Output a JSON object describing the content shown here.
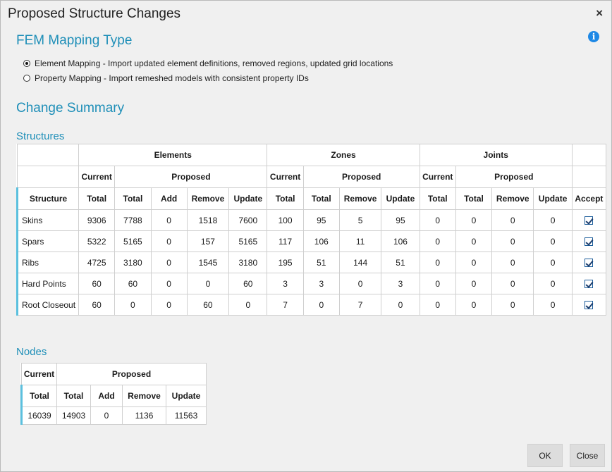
{
  "dialog": {
    "title": "Proposed Structure Changes",
    "close_glyph": "×",
    "info_glyph": "i"
  },
  "mapping": {
    "heading": "FEM Mapping Type",
    "options": [
      {
        "label": "Element Mapping - Import updated element definitions, removed regions, updated grid locations",
        "selected": true
      },
      {
        "label": "Property Mapping - Import remeshed models with consistent property IDs",
        "selected": false
      }
    ]
  },
  "summary": {
    "heading": "Change Summary"
  },
  "structures": {
    "heading": "Structures",
    "groups": {
      "elements": "Elements",
      "zones": "Zones",
      "joints": "Joints"
    },
    "sub": {
      "current": "Current",
      "proposed": "Proposed"
    },
    "columns": [
      "Structure",
      "Total",
      "Total",
      "Add",
      "Remove",
      "Update",
      "Total",
      "Total",
      "Remove",
      "Update",
      "Total",
      "Total",
      "Remove",
      "Update",
      "Accept"
    ],
    "rows": [
      {
        "name": "Skins",
        "values": [
          "9306",
          "7788",
          "0",
          "1518",
          "7600",
          "100",
          "95",
          "5",
          "95",
          "0",
          "0",
          "0",
          "0"
        ],
        "accept": true
      },
      {
        "name": "Spars",
        "values": [
          "5322",
          "5165",
          "0",
          "157",
          "5165",
          "117",
          "106",
          "11",
          "106",
          "0",
          "0",
          "0",
          "0"
        ],
        "accept": true
      },
      {
        "name": "Ribs",
        "values": [
          "4725",
          "3180",
          "0",
          "1545",
          "3180",
          "195",
          "51",
          "144",
          "51",
          "0",
          "0",
          "0",
          "0"
        ],
        "accept": true
      },
      {
        "name": "Hard Points",
        "values": [
          "60",
          "60",
          "0",
          "0",
          "60",
          "3",
          "3",
          "0",
          "3",
          "0",
          "0",
          "0",
          "0"
        ],
        "accept": true
      },
      {
        "name": "Root Closeout",
        "values": [
          "60",
          "0",
          "0",
          "60",
          "0",
          "7",
          "0",
          "7",
          "0",
          "0",
          "0",
          "0",
          "0"
        ],
        "accept": true
      }
    ]
  },
  "nodes": {
    "heading": "Nodes",
    "sub": {
      "current": "Current",
      "proposed": "Proposed"
    },
    "columns": [
      "Total",
      "Total",
      "Add",
      "Remove",
      "Update"
    ],
    "values": [
      "16039",
      "14903",
      "0",
      "1136",
      "11563"
    ]
  },
  "buttons": {
    "ok": "OK",
    "close": "Close"
  }
}
